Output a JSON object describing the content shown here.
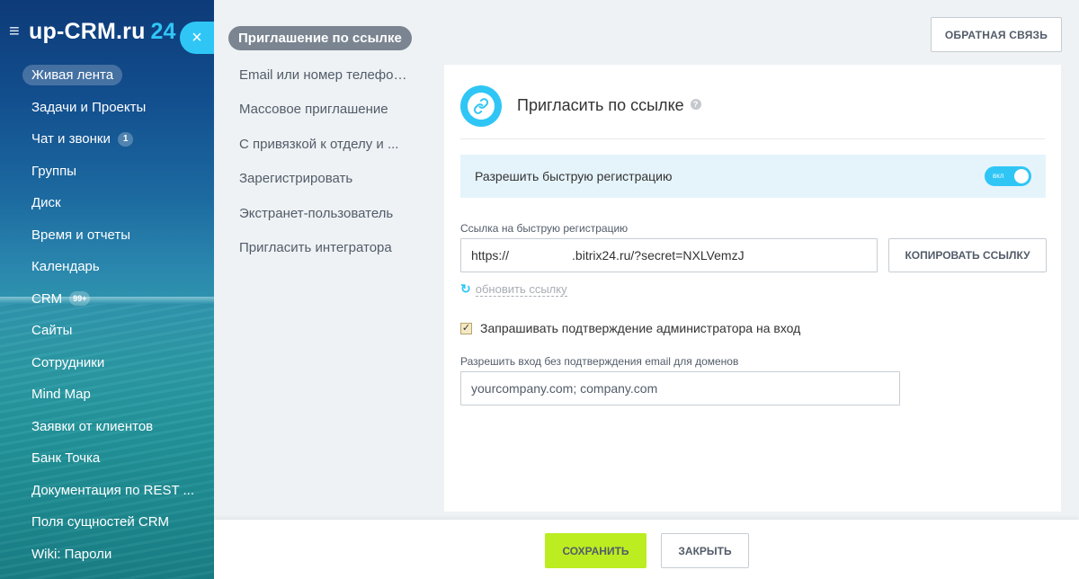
{
  "sidebar": {
    "logo_text": "up-CRM.ru",
    "logo_number": "24",
    "items": [
      {
        "label": "Живая лента",
        "active": true
      },
      {
        "label": "Задачи и Проекты"
      },
      {
        "label": "Чат и звонки",
        "counter": "1"
      },
      {
        "label": "Группы"
      },
      {
        "label": "Диск"
      },
      {
        "label": "Время и отчеты"
      },
      {
        "label": "Календарь"
      },
      {
        "label": "CRM",
        "counter": "99+"
      },
      {
        "label": "Сайты"
      },
      {
        "label": "Сотрудники"
      },
      {
        "label": "Mind Map"
      },
      {
        "label": "Заявки от клиентов"
      },
      {
        "label": "Банк Точка"
      },
      {
        "label": "Документация по REST ..."
      },
      {
        "label": "Поля сущностей CRM"
      },
      {
        "label": "Wiki: Пароли"
      }
    ]
  },
  "close_tab": {
    "icon": "×"
  },
  "inner_nav": {
    "items": [
      {
        "label": "Приглашение по ссылке",
        "active": true
      },
      {
        "label": "Email или номер телефона"
      },
      {
        "label": "Массовое приглашение"
      },
      {
        "label": "С привязкой к отделу и ..."
      },
      {
        "label": "Зарегистрировать"
      },
      {
        "label": "Экстранет-пользователь"
      },
      {
        "label": "Пригласить интегратора"
      }
    ]
  },
  "feedback_button": "Обратная связь",
  "invite": {
    "title": "Пригласить по ссылке",
    "help_icon": "?",
    "fast_registration_label": "Разрешить быструю регистрацию",
    "toggle_state": "вкл",
    "toggle_on": true,
    "link_label": "Ссылка на быструю регистрацию",
    "link_prefix": "https://",
    "link_suffix": ".bitrix24.ru/?secret=NXLVemzJ",
    "copy_button": "Копировать ссылку",
    "refresh_link": "обновить ссылку",
    "admin_confirm_label": "Запрашивать подтверждение администратора на вход",
    "admin_confirm_checked": true,
    "domains_label": "Разрешить вход без подтверждения email для доменов",
    "domains_value": "yourcompany.com; company.com"
  },
  "footer": {
    "save": "Сохранить",
    "close": "Закрыть"
  },
  "colors": {
    "accent": "#2fc6f6",
    "save_green": "#bbed21",
    "fast_reg_bg": "#e5f4fb"
  }
}
